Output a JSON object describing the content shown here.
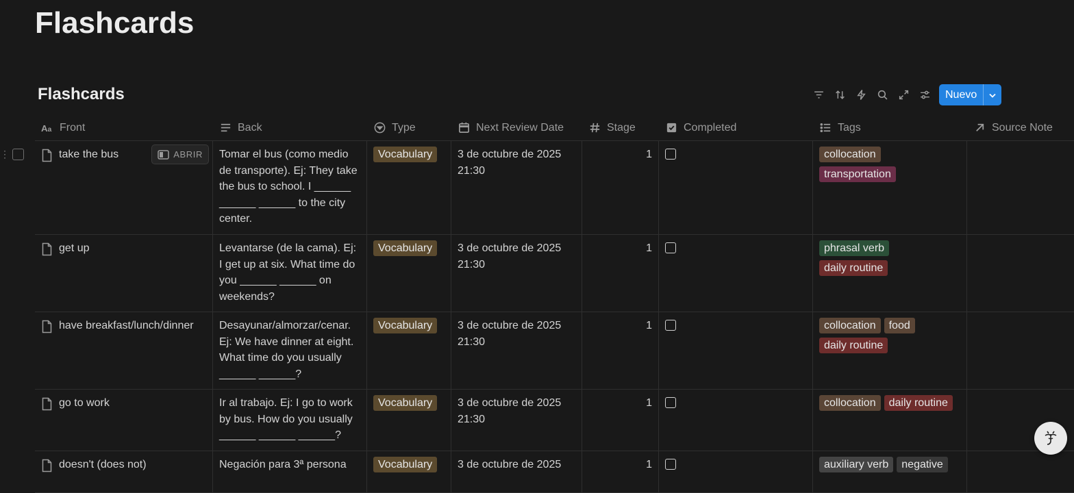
{
  "page": {
    "title": "Flashcards"
  },
  "database": {
    "title": "Flashcards",
    "new_button": "Nuevo"
  },
  "columns": [
    {
      "label": "Front",
      "icon": "title-icon"
    },
    {
      "label": "Back",
      "icon": "text-icon"
    },
    {
      "label": "Type",
      "icon": "select-icon"
    },
    {
      "label": "Next Review Date",
      "icon": "calendar-icon"
    },
    {
      "label": "Stage",
      "icon": "number-icon"
    },
    {
      "label": "Completed",
      "icon": "checkbox-icon"
    },
    {
      "label": "Tags",
      "icon": "list-icon"
    },
    {
      "label": "Source Note",
      "icon": "relation-icon"
    }
  ],
  "open_label": "ABRIR",
  "rows": [
    {
      "front": "take the bus",
      "back": "Tomar el bus (como medio de transporte). Ej: They take the bus to school. I ______ ______ ______ to the city center.",
      "type": "Vocabulary",
      "date": "3 de octubre de 2025 21:30",
      "stage": "1",
      "tags": [
        "collocation",
        "transportation"
      ]
    },
    {
      "front": "get up",
      "back": "Levantarse (de la cama). Ej: I get up at six. What time do you ______ ______ on weekends?",
      "type": "Vocabulary",
      "date": "3 de octubre de 2025 21:30",
      "stage": "1",
      "tags": [
        "phrasal verb",
        "daily routine"
      ]
    },
    {
      "front": "have breakfast/lunch/dinner",
      "back": "Desayunar/almorzar/cenar. Ej: We have dinner at eight. What time do you usually ______ ______?",
      "type": "Vocabulary",
      "date": "3 de octubre de 2025 21:30",
      "stage": "1",
      "tags": [
        "collocation",
        "food",
        "daily routine"
      ]
    },
    {
      "front": "go to work",
      "back": "Ir al trabajo. Ej: I go to work by bus. How do you usually ______ ______ ______?",
      "type": "Vocabulary",
      "date": "3 de octubre de 2025 21:30",
      "stage": "1",
      "tags": [
        "collocation",
        "daily routine"
      ]
    },
    {
      "front": "doesn't (does not)",
      "back": "Negación para 3ª persona",
      "type": "Vocabulary",
      "date": "3 de octubre de 2025",
      "stage": "1",
      "tags": [
        "auxiliary verb",
        "negative"
      ]
    }
  ],
  "tag_colors": {
    "collocation": "#5a4536",
    "transportation": "#6b2e48",
    "phrasal verb": "#2b5038",
    "daily routine": "#6e2d2c",
    "food": "#5a4536",
    "auxiliary verb": "#444444",
    "negative": "#383838"
  }
}
